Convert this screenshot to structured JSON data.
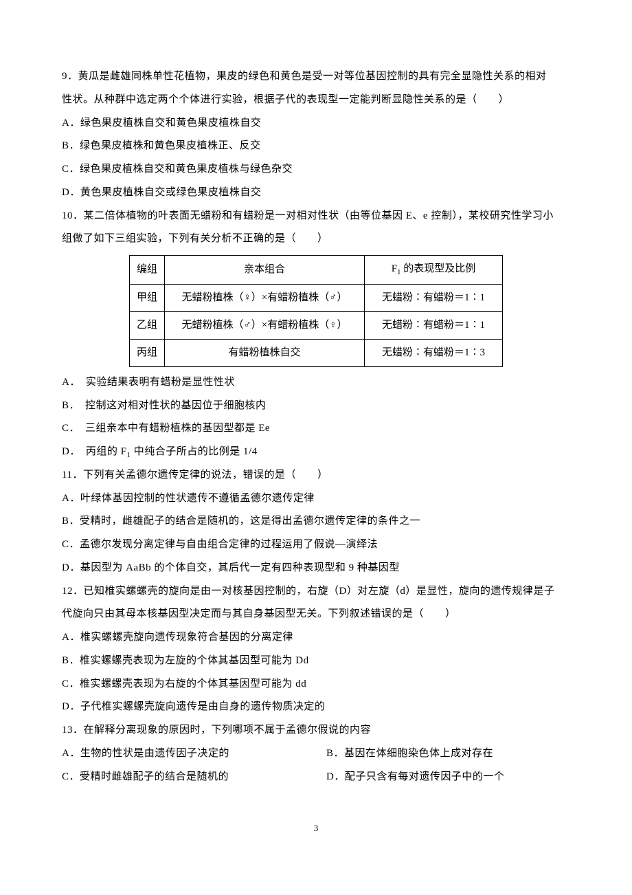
{
  "q9": {
    "stem1": "9．黄瓜是雌雄同株单性花植物，果皮的绿色和黄色是受一对等位基因控制的具有完全显隐性关系的相对",
    "stem2": "性状。从种群中选定两个个体进行实验，根据子代的表现型一定能判断显隐性关系的是（　　）",
    "a": "A．绿色果皮植株自交和黄色果皮植株自交",
    "b": "B．绿色果皮植株和黄色果皮植株正、反交",
    "c": "C．绿色果皮植株自交和黄色果皮植株与绿色杂交",
    "d": "D．黄色果皮植株自交或绿色果皮植株自交"
  },
  "q10": {
    "stem1": "10．某二倍体植物的叶表面无蜡粉和有蜡粉是一对相对性状（由等位基因 E、e 控制），某校研究性学习小",
    "stem2": "组做了如下三组实验，下列有关分析不正确的是（　　）",
    "table": {
      "h1": "编组",
      "h2": "亲本组合",
      "h3_pre": "F",
      "h3_sub": "1",
      "h3_post": " 的表现型及比例",
      "r1c1": "甲组",
      "r1c2": "无蜡粉植株（♀）×有蜡粉植株（♂）",
      "r1c3": "无蜡粉∶有蜡粉＝1∶1",
      "r2c1": "乙组",
      "r2c2": "无蜡粉植株（♂）×有蜡粉植株（♀）",
      "r2c3": "无蜡粉∶有蜡粉＝1∶1",
      "r3c1": "丙组",
      "r3c2": "有蜡粉植株自交",
      "r3c3": "无蜡粉∶有蜡粉＝1∶3"
    },
    "a": "A．　实验结果表明有蜡粉是显性性状",
    "b": "B．　控制这对相对性状的基因位于细胞核内",
    "c": "C．　三组亲本中有蜡粉植株的基因型都是 Ee",
    "d_pre": "D．　丙组的 F",
    "d_sub": "1",
    "d_post": " 中纯合子所占的比例是 1/4"
  },
  "q11": {
    "stem": "11．下列有关孟德尔遗传定律的说法，错误的是（　　）",
    "a": "A．叶绿体基因控制的性状遗传不遵循孟德尔遗传定律",
    "b": "B．受精时，雌雄配子的结合是随机的，这是得出孟德尔遗传定律的条件之一",
    "c": "C．孟德尔发现分离定律与自由组合定律的过程运用了假说—演绎法",
    "d": "D．基因型为 AaBb 的个体自交，其后代一定有四种表现型和 9 种基因型"
  },
  "q12": {
    "stem1": "12．已知椎实螺螺壳的旋向是由一对核基因控制的，右旋（D）对左旋（d）是显性，旋向的遗传规律是子",
    "stem2": "代旋向只由其母本核基因型决定而与其自身基因型无关。下列叙述错误的是（　　）",
    "a": "A．椎实螺螺壳旋向遗传现象符合基因的分离定律",
    "b": "B．椎实螺螺壳表现为左旋的个体其基因型可能为 Dd",
    "c": "C．椎实螺螺壳表现为右旋的个体其基因型可能为 dd",
    "d": "D．子代椎实螺螺壳旋向遗传是由自身的遗传物质决定的"
  },
  "q13": {
    "stem": "13．在解释分离现象的原因时，下列哪项不属于孟德尔假说的内容",
    "a": "A．生物的性状是由遗传因子决定的",
    "b": "B．基因在体细胞染色体上成对存在",
    "c": "C．受精时雌雄配子的结合是随机的",
    "d": "D．配子只含有每对遗传因子中的一个"
  },
  "page_number": "3"
}
